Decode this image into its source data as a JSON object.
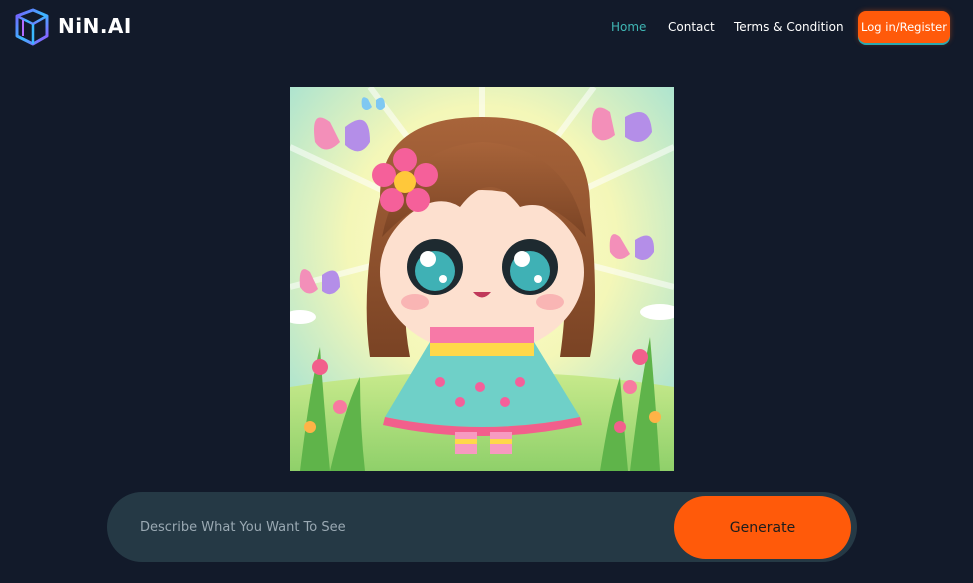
{
  "brand": {
    "name": "NiN.AI",
    "logo_icon": "cube-logo-icon"
  },
  "nav": {
    "items": [
      {
        "label": "Home",
        "active": true
      },
      {
        "label": "Contact"
      },
      {
        "label": "Terms & Condition"
      }
    ],
    "login_label": "Log in/Register"
  },
  "generated_image": {
    "description_icon": "generated-artwork-image"
  },
  "prompt": {
    "placeholder": "Describe What You Want To See",
    "value": "",
    "generate_label": "Generate"
  },
  "colors": {
    "background": "#121a2a",
    "accent": "#ff5a0a",
    "active_link": "#3fb6b4",
    "prompt_bar": "#253945"
  }
}
